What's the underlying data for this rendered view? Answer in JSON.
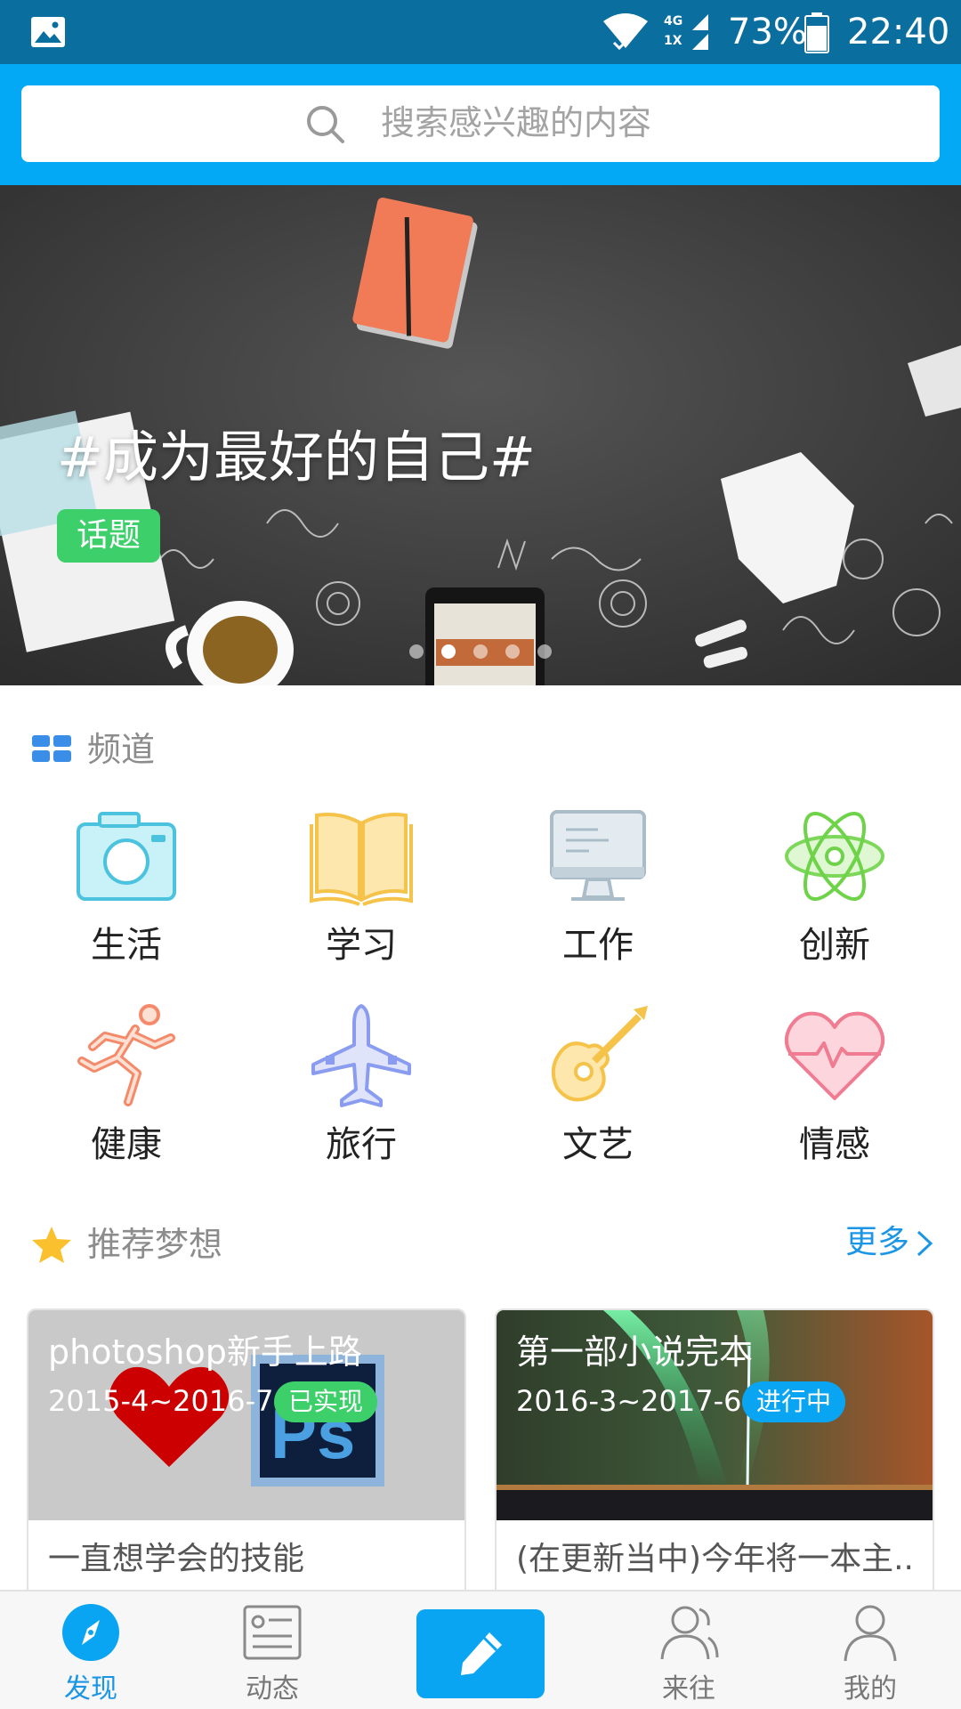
{
  "status_bar": {
    "network_top": "4G",
    "network_bottom": "1X",
    "battery_percent": "73%",
    "time": "22:40"
  },
  "search": {
    "placeholder": "搜索感兴趣的内容"
  },
  "banner": {
    "title": "#成为最好的自己#",
    "tag": "话题",
    "slide_count": 5,
    "active_slide": 2
  },
  "channels": {
    "heading": "频道",
    "items": [
      {
        "label": "生活",
        "icon": "camera-icon"
      },
      {
        "label": "学习",
        "icon": "book-icon"
      },
      {
        "label": "工作",
        "icon": "monitor-icon"
      },
      {
        "label": "创新",
        "icon": "atom-icon"
      },
      {
        "label": "健康",
        "icon": "runner-icon"
      },
      {
        "label": "旅行",
        "icon": "airplane-icon"
      },
      {
        "label": "文艺",
        "icon": "guitar-icon"
      },
      {
        "label": "情感",
        "icon": "heart-pulse-icon"
      }
    ]
  },
  "recommend": {
    "heading": "推荐梦想",
    "more": "更多",
    "cards": [
      {
        "title": "photoshop新手上路",
        "dates": "2015-4~2016-7",
        "status": "已实现",
        "status_color": "#3ccf6a",
        "desc": "一直想学会的技能"
      },
      {
        "title": "第一部小说完本",
        "dates": "2016-3~2017-6",
        "status": "进行中",
        "status_color": "#0aa5f2",
        "desc": "(在更新当中)今年将一本主..."
      }
    ]
  },
  "bottom_nav": {
    "items": [
      {
        "label": "发现",
        "active": true
      },
      {
        "label": "动态",
        "active": false
      },
      {
        "label": "来往",
        "active": false
      },
      {
        "label": "我的",
        "active": false
      }
    ]
  },
  "colors": {
    "status_bar": "#0a6e9f",
    "header": "#03a9f4",
    "accent": "#1b95e6",
    "tag_green": "#3ccf6a"
  }
}
